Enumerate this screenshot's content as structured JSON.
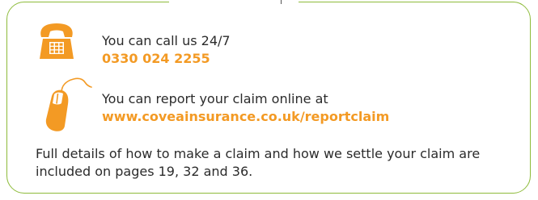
{
  "colors": {
    "accent": "#f39a24",
    "border": "#8dbb3a",
    "text": "#2b2b2b"
  },
  "icons": {
    "phone": "telephone-icon",
    "mouse": "computer-mouse-icon"
  },
  "call": {
    "text": "You can call us 24/7",
    "number": "0330 024 2255"
  },
  "report": {
    "text": "You can report your claim online at",
    "url": "www.coveainsurance.co.uk/reportclaim"
  },
  "details": "Full details of how to make a claim and how we settle your claim are included on pages 19, 32 and 36."
}
